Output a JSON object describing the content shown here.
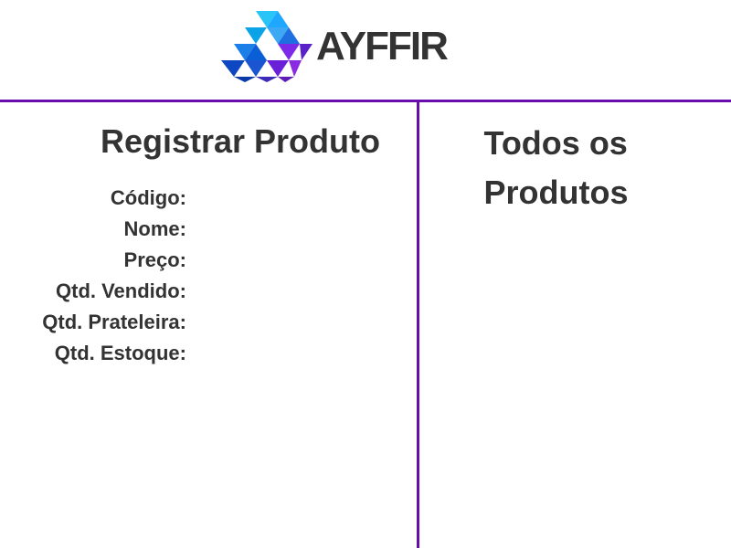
{
  "header": {
    "brand": "AYFFIR",
    "logo_icon": "ayffir-logo-mark",
    "colors": {
      "divider": "#6a0dad",
      "logo_blue": "#1e90ff",
      "logo_purple": "#8a2be2",
      "text": "#333333"
    }
  },
  "register": {
    "title": "Registrar Produto",
    "fields": [
      {
        "label": "Código:",
        "value": ""
      },
      {
        "label": "Nome:",
        "value": ""
      },
      {
        "label": "Preço:",
        "value": ""
      },
      {
        "label": "Qtd. Vendido:",
        "value": ""
      },
      {
        "label": "Qtd. Prateleira:",
        "value": ""
      },
      {
        "label": "Qtd. Estoque:",
        "value": ""
      }
    ]
  },
  "products": {
    "title": "Todos os Produtos",
    "items": []
  }
}
